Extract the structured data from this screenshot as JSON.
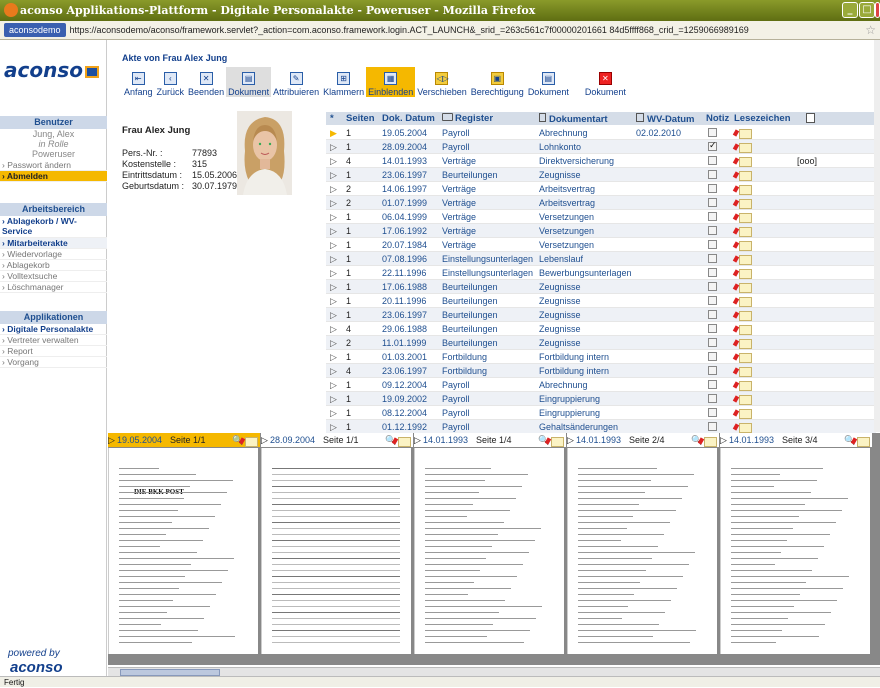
{
  "window": {
    "title": "aconso Applikations-Plattform - Digitale Personalakte - Poweruser - Mozilla Firefox"
  },
  "address_bar": {
    "site": "aconsodemo",
    "url": "https://aconsodemo/aconso/framework.servlet?_action=com.aconso.framework.login.ACT_LAUNCH&_srid_=263c561c7f00000201661 84d5ffff868_crid_=1259066989169"
  },
  "sidebar": {
    "logo": "aconso",
    "benutzer_header": "Benutzer",
    "user_name": "Jung, Alex",
    "user_role": "in Rolle",
    "user_type": "Poweruser",
    "user_items": [
      {
        "label": "Passwort ändern"
      },
      {
        "label": "Abmelden"
      }
    ],
    "arbeitsbereich_header": "Arbeitsbereich",
    "arbeitsbereich_items": [
      {
        "label": "Ablagekorb / WV-Service"
      },
      {
        "label": "Mitarbeiterakte"
      },
      {
        "label": "Wiedervorlage"
      },
      {
        "label": "Ablagekorb"
      },
      {
        "label": "Volltextsuche"
      },
      {
        "label": "Löschmanager"
      }
    ],
    "applikationen_header": "Applikationen",
    "applikationen_items": [
      {
        "label": "Digitale Personalakte"
      },
      {
        "label": "Vertreter verwalten"
      },
      {
        "label": "Report"
      },
      {
        "label": "Vorgang"
      }
    ],
    "powered_by": "powered by",
    "footer_logo": "aconso"
  },
  "toolbar": {
    "title": "Akte von Frau Alex Jung",
    "buttons": [
      {
        "label": "Anfang",
        "icon": "home-icon"
      },
      {
        "label": "Zurück",
        "icon": "back-icon"
      },
      {
        "label": "Beenden",
        "icon": "close-icon"
      },
      {
        "label": "Dokument",
        "icon": "document-icon"
      },
      {
        "label": "Attribuieren",
        "icon": "attribute-icon"
      },
      {
        "label": "Klammern",
        "icon": "clip-icon"
      },
      {
        "label": "Einblenden",
        "icon": "show-icon"
      },
      {
        "label": "Verschieben",
        "icon": "move-icon"
      },
      {
        "label": "Berechtigung",
        "icon": "permission-icon"
      },
      {
        "label": "Dokument",
        "icon": "save-document-icon"
      },
      {
        "label": "Dokument",
        "icon": "delete-document-icon"
      }
    ]
  },
  "employee": {
    "name": "Frau Alex Jung",
    "fields": [
      {
        "label": "Pers.-Nr. :",
        "value": "77893"
      },
      {
        "label": "Kostenstelle :",
        "value": "315"
      },
      {
        "label": "Eintrittsdatum :",
        "value": "15.05.2006"
      },
      {
        "label": "Geburtsdatum :",
        "value": "30.07.1979"
      }
    ]
  },
  "table": {
    "headers": {
      "star": "*",
      "seiten": "Seiten",
      "datum": "Dok. Datum",
      "register": "Register",
      "art": "Dokumentart",
      "wv": "WV-Datum",
      "notiz": "Notiz",
      "lesezeichen": "Lesezeichen"
    },
    "rows": [
      {
        "seiten": "1",
        "datum": "19.05.2004",
        "register": "Payroll",
        "art": "Abrechnung",
        "wv": "02.02.2010",
        "notiz": false,
        "extra": ""
      },
      {
        "seiten": "1",
        "datum": "28.09.2004",
        "register": "Payroll",
        "art": "Lohnkonto",
        "wv": "",
        "notiz": true,
        "extra": ""
      },
      {
        "seiten": "4",
        "datum": "14.01.1993",
        "register": "Verträge",
        "art": "Direktversicherung",
        "wv": "",
        "notiz": false,
        "extra": "[ooo]"
      },
      {
        "seiten": "1",
        "datum": "23.06.1997",
        "register": "Beurteilungen",
        "art": "Zeugnisse",
        "wv": "",
        "notiz": false,
        "extra": ""
      },
      {
        "seiten": "2",
        "datum": "14.06.1997",
        "register": "Verträge",
        "art": "Arbeitsvertrag",
        "wv": "",
        "notiz": false,
        "extra": ""
      },
      {
        "seiten": "2",
        "datum": "01.07.1999",
        "register": "Verträge",
        "art": "Arbeitsvertrag",
        "wv": "",
        "notiz": false,
        "extra": ""
      },
      {
        "seiten": "1",
        "datum": "06.04.1999",
        "register": "Verträge",
        "art": "Versetzungen",
        "wv": "",
        "notiz": false,
        "extra": ""
      },
      {
        "seiten": "1",
        "datum": "17.06.1992",
        "register": "Verträge",
        "art": "Versetzungen",
        "wv": "",
        "notiz": false,
        "extra": ""
      },
      {
        "seiten": "1",
        "datum": "20.07.1984",
        "register": "Verträge",
        "art": "Versetzungen",
        "wv": "",
        "notiz": false,
        "extra": ""
      },
      {
        "seiten": "1",
        "datum": "07.08.1996",
        "register": "Einstellungsunterlagen",
        "art": "Lebenslauf",
        "wv": "",
        "notiz": false,
        "extra": ""
      },
      {
        "seiten": "1",
        "datum": "22.11.1996",
        "register": "Einstellungsunterlagen",
        "art": "Bewerbungsunterlagen",
        "wv": "",
        "notiz": false,
        "extra": ""
      },
      {
        "seiten": "1",
        "datum": "17.06.1988",
        "register": "Beurteilungen",
        "art": "Zeugnisse",
        "wv": "",
        "notiz": false,
        "extra": ""
      },
      {
        "seiten": "1",
        "datum": "20.11.1996",
        "register": "Beurteilungen",
        "art": "Zeugnisse",
        "wv": "",
        "notiz": false,
        "extra": ""
      },
      {
        "seiten": "1",
        "datum": "23.06.1997",
        "register": "Beurteilungen",
        "art": "Zeugnisse",
        "wv": "",
        "notiz": false,
        "extra": ""
      },
      {
        "seiten": "4",
        "datum": "29.06.1988",
        "register": "Beurteilungen",
        "art": "Zeugnisse",
        "wv": "",
        "notiz": false,
        "extra": ""
      },
      {
        "seiten": "2",
        "datum": "11.01.1999",
        "register": "Beurteilungen",
        "art": "Zeugnisse",
        "wv": "",
        "notiz": false,
        "extra": ""
      },
      {
        "seiten": "1",
        "datum": "01.03.2001",
        "register": "Fortbildung",
        "art": "Fortbildung intern",
        "wv": "",
        "notiz": false,
        "extra": ""
      },
      {
        "seiten": "4",
        "datum": "23.06.1997",
        "register": "Fortbildung",
        "art": "Fortbildung intern",
        "wv": "",
        "notiz": false,
        "extra": ""
      },
      {
        "seiten": "1",
        "datum": "09.12.2004",
        "register": "Payroll",
        "art": "Abrechnung",
        "wv": "",
        "notiz": false,
        "extra": ""
      },
      {
        "seiten": "1",
        "datum": "19.09.2002",
        "register": "Payroll",
        "art": "Eingruppierung",
        "wv": "",
        "notiz": false,
        "extra": ""
      },
      {
        "seiten": "1",
        "datum": "08.12.2004",
        "register": "Payroll",
        "art": "Eingruppierung",
        "wv": "",
        "notiz": false,
        "extra": ""
      },
      {
        "seiten": "1",
        "datum": "01.12.1992",
        "register": "Payroll",
        "art": "Gehaltsänderungen",
        "wv": "",
        "notiz": false,
        "extra": ""
      }
    ]
  },
  "viewer": {
    "pages": [
      {
        "date": "19.05.2004",
        "page": "Seite 1/1",
        "heading": "DIE BKK POST"
      },
      {
        "date": "28.09.2004",
        "page": "Seite 1/1",
        "heading": ""
      },
      {
        "date": "14.01.1993",
        "page": "Seite 1/4",
        "heading": ""
      },
      {
        "date": "14.01.1993",
        "page": "Seite 2/4",
        "heading": ""
      },
      {
        "date": "14.01.1993",
        "page": "Seite 3/4",
        "heading": ""
      }
    ]
  },
  "status": {
    "text": "Fertig"
  },
  "colors": {
    "accent": "#f5b800",
    "brand": "#123f8c",
    "titlebar": "#6f7d1c"
  }
}
